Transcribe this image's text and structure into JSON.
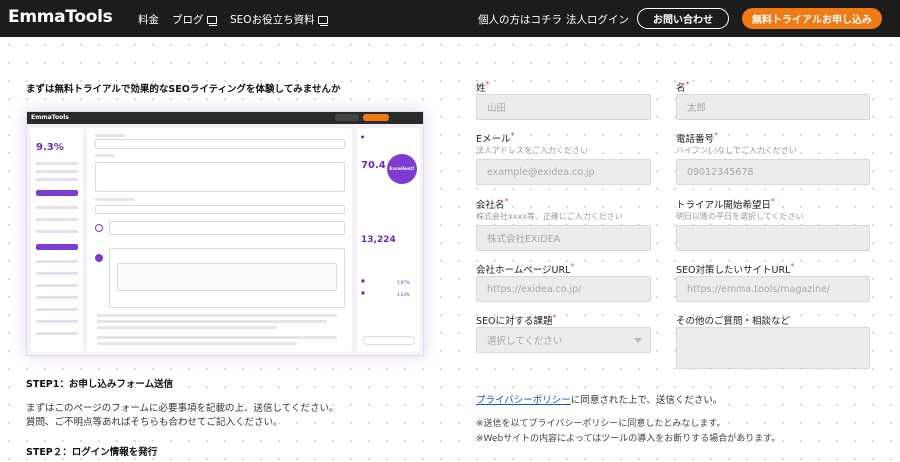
{
  "nav": {
    "logo": "EmmaTools",
    "links": [
      "料金",
      "ブログ",
      "SEOお役立ち資料",
      "個人の方はコチラ",
      "法人ログイン"
    ],
    "contact_label": "お問い合わせ",
    "trial_label": "無料トライアルお申し込み"
  },
  "lead": "まずは無料トライアルで効果的なSEOライティングを体験してみませんか",
  "mock": {
    "brand": "EmmaTools",
    "score": "70.4",
    "badge": "Excellent!",
    "count": "13,224",
    "percent": "9.3%"
  },
  "steps": {
    "step1_title": "STEP1：お申し込みフォーム送信",
    "step1_line1": "まずはこのページのフォームに必要事項を記載の上、送信してください。",
    "step1_line2": "質問、ご不明点等あればそちらも合わせてご記入ください。",
    "step2_title": "STEP２：ログイン情報を発行"
  },
  "form": {
    "last_name": {
      "label": "姓",
      "placeholder": "山田"
    },
    "first_name": {
      "label": "名",
      "placeholder": "太郎"
    },
    "email": {
      "label": "Eメール",
      "hint": "法人アドレスをご入力ください",
      "placeholder": "example@exidea.co.jp"
    },
    "phone": {
      "label": "電話番号",
      "hint": "ハイフン(-)なしでご入力ください",
      "placeholder": "09012345678"
    },
    "company": {
      "label": "会社名",
      "hint": "株式会社xxxx等、正確にご入力ください",
      "placeholder": "株式会社EXIDEA"
    },
    "start_date": {
      "label": "トライアル開始希望日",
      "hint": "明日以降の平日を選択してください",
      "placeholder": ""
    },
    "homepage": {
      "label": "会社ホームページURL",
      "placeholder": "https://exidea.co.jp/"
    },
    "seo_site": {
      "label": "SEO対策したいサイトURL",
      "placeholder": "https://emma.tools/magazine/"
    },
    "issue": {
      "label": "SEOに対する課題",
      "selected": "選択してください"
    },
    "other": {
      "label": "その他のご質問・相談など",
      "placeholder": ""
    }
  },
  "privacy": {
    "link": "プライバシーポリシー",
    "text": "に同意された上で、送信ください。"
  },
  "notes": [
    "※送信を以てプライバシーポリシーに同意したとみなします。",
    "※Webサイトの内容によってはツールの導入をお断りする場合があります。"
  ]
}
